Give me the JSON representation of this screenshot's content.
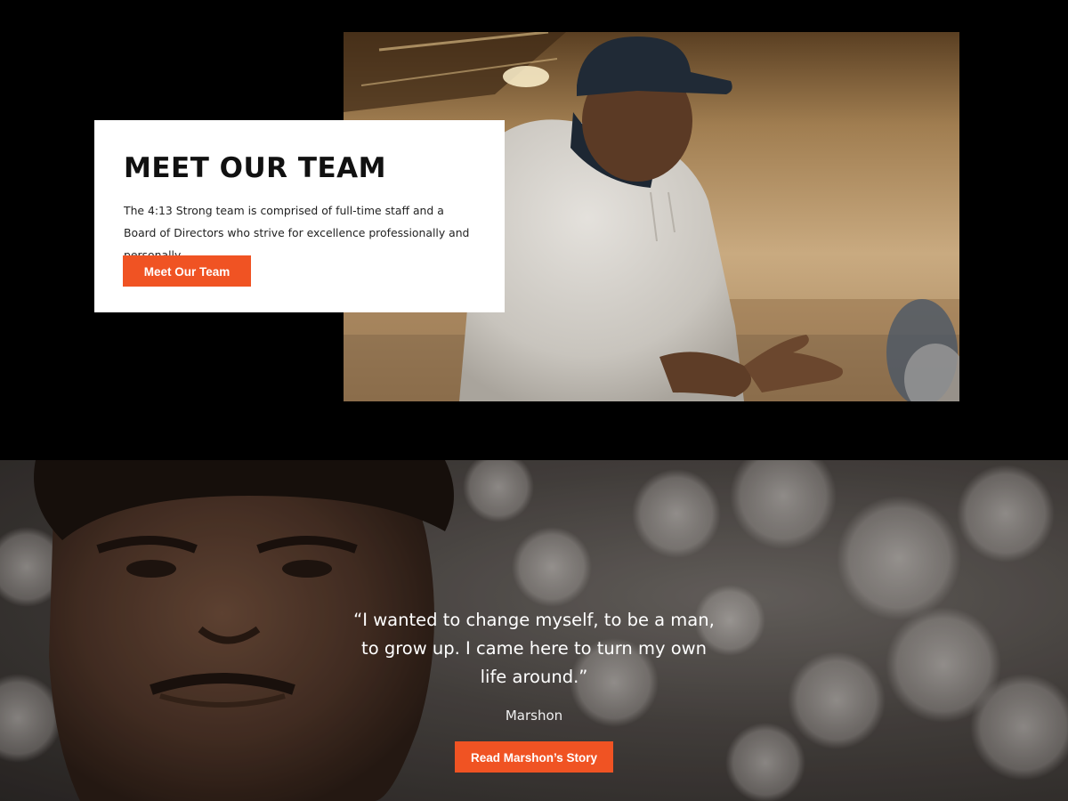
{
  "team": {
    "title": "MEET OUR TEAM",
    "description": "The 4:13 Strong team is comprised of full-time staff and a Board of Directors who strive for excellence professionally and personally.",
    "button_label": "Meet Our Team"
  },
  "testimonial": {
    "quote": "“I wanted to change myself, to be a man, to grow up. I came here to turn my own life around.”",
    "name": "Marshon",
    "button_label": "Read Marshon’s Story"
  },
  "colors": {
    "accent": "#f05323",
    "top_background": "#000000",
    "card_background": "#ffffff"
  }
}
